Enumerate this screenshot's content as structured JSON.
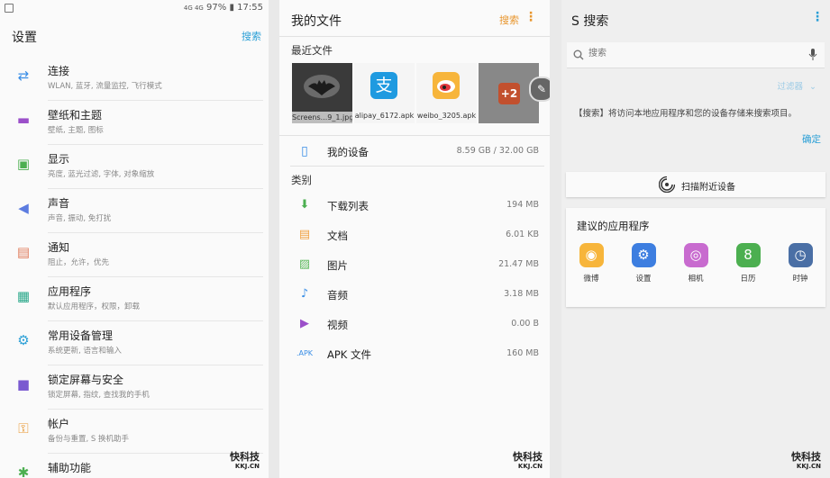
{
  "status": {
    "indicators": "4G 4G",
    "battery": "97%",
    "time": "17:55"
  },
  "settings": {
    "title": "设置",
    "search": "搜索",
    "items": [
      {
        "title": "连接",
        "sub": "WLAN, 蓝牙, 流量监控, 飞行模式",
        "icon": "connection-icon",
        "color": "#3a8ee6"
      },
      {
        "title": "壁纸和主题",
        "sub": "壁纸, 主题, 图标",
        "icon": "wallpaper-icon",
        "color": "#9b4fc9"
      },
      {
        "title": "显示",
        "sub": "亮度, 蓝光过滤, 字体, 对象缩放",
        "icon": "display-icon",
        "color": "#4caf50"
      },
      {
        "title": "声音",
        "sub": "声音, 振动, 免打扰",
        "icon": "sound-icon",
        "color": "#5c7ce0"
      },
      {
        "title": "通知",
        "sub": "阻止，允许，优先",
        "icon": "notification-icon",
        "color": "#e07c5c"
      },
      {
        "title": "应用程序",
        "sub": "默认应用程序，权限，卸载",
        "icon": "apps-icon",
        "color": "#2aa88a"
      },
      {
        "title": "常用设备管理",
        "sub": "系统更新, 语言和输入",
        "icon": "device-management-icon",
        "color": "#2a9fd6"
      },
      {
        "title": "锁定屏幕与安全",
        "sub": "锁定屏幕, 指纹, 查找我的手机",
        "icon": "lock-icon",
        "color": "#7a5ad0"
      },
      {
        "title": "帐户",
        "sub": "备份与重置, S 换机助手",
        "icon": "key-icon",
        "color": "#e8962e"
      },
      {
        "title": "辅助功能",
        "sub": "",
        "icon": "accessibility-icon",
        "color": "#4caf50"
      }
    ]
  },
  "files": {
    "title": "我的文件",
    "search": "搜索",
    "recent_label": "最近文件",
    "recent": [
      {
        "name": "Screens...9_1.jpg",
        "icon": "batman-thumbnail"
      },
      {
        "name": "alipay_6172.apk",
        "icon": "alipay-icon"
      },
      {
        "name": "weibo_3205.apk",
        "icon": "weibo-icon"
      },
      {
        "name": "+2",
        "icon": "more-thumbnail"
      }
    ],
    "device": {
      "name": "我的设备",
      "size": "8.59 GB / 32.00 GB"
    },
    "category_label": "类别",
    "categories": [
      {
        "name": "下载列表",
        "size": "194 MB",
        "icon": "download-icon",
        "color": "#4caf50"
      },
      {
        "name": "文档",
        "size": "6.01 KB",
        "icon": "document-icon",
        "color": "#f0a040"
      },
      {
        "name": "图片",
        "size": "21.47 MB",
        "icon": "image-icon",
        "color": "#5cb85c"
      },
      {
        "name": "音频",
        "size": "3.18 MB",
        "icon": "music-icon",
        "color": "#3a8ee6"
      },
      {
        "name": "视频",
        "size": "0.00 B",
        "icon": "video-icon",
        "color": "#9b4fc9"
      },
      {
        "name": "APK 文件",
        "size": "160 MB",
        "icon": ".APK",
        "color": "#3a8ee6"
      }
    ]
  },
  "ssearch": {
    "title": "S 搜索",
    "placeholder": "搜索",
    "filter": "过滤器",
    "message": "【搜索】将访问本地应用程序和您的设备存储来搜索项目。",
    "confirm": "确定",
    "scan": "扫描附近设备",
    "suggested_title": "建议的应用程序",
    "apps": [
      {
        "name": "微博",
        "icon": "weibo-icon",
        "color": "#f7b53b"
      },
      {
        "name": "设置",
        "icon": "settings-gear-icon",
        "color": "#3d7ee0"
      },
      {
        "name": "相机",
        "icon": "camera-icon",
        "color": "#c86bcf"
      },
      {
        "name": "日历",
        "icon": "calendar-icon",
        "color": "#4caf50"
      },
      {
        "name": "时钟",
        "icon": "clock-icon",
        "color": "#4a6fa5"
      }
    ]
  },
  "watermark": {
    "brand": "快科技",
    "domain": "KKJ.CN"
  },
  "colors": {
    "accent_blue": "#2a9fd6",
    "accent_orange": "#e8962e"
  }
}
